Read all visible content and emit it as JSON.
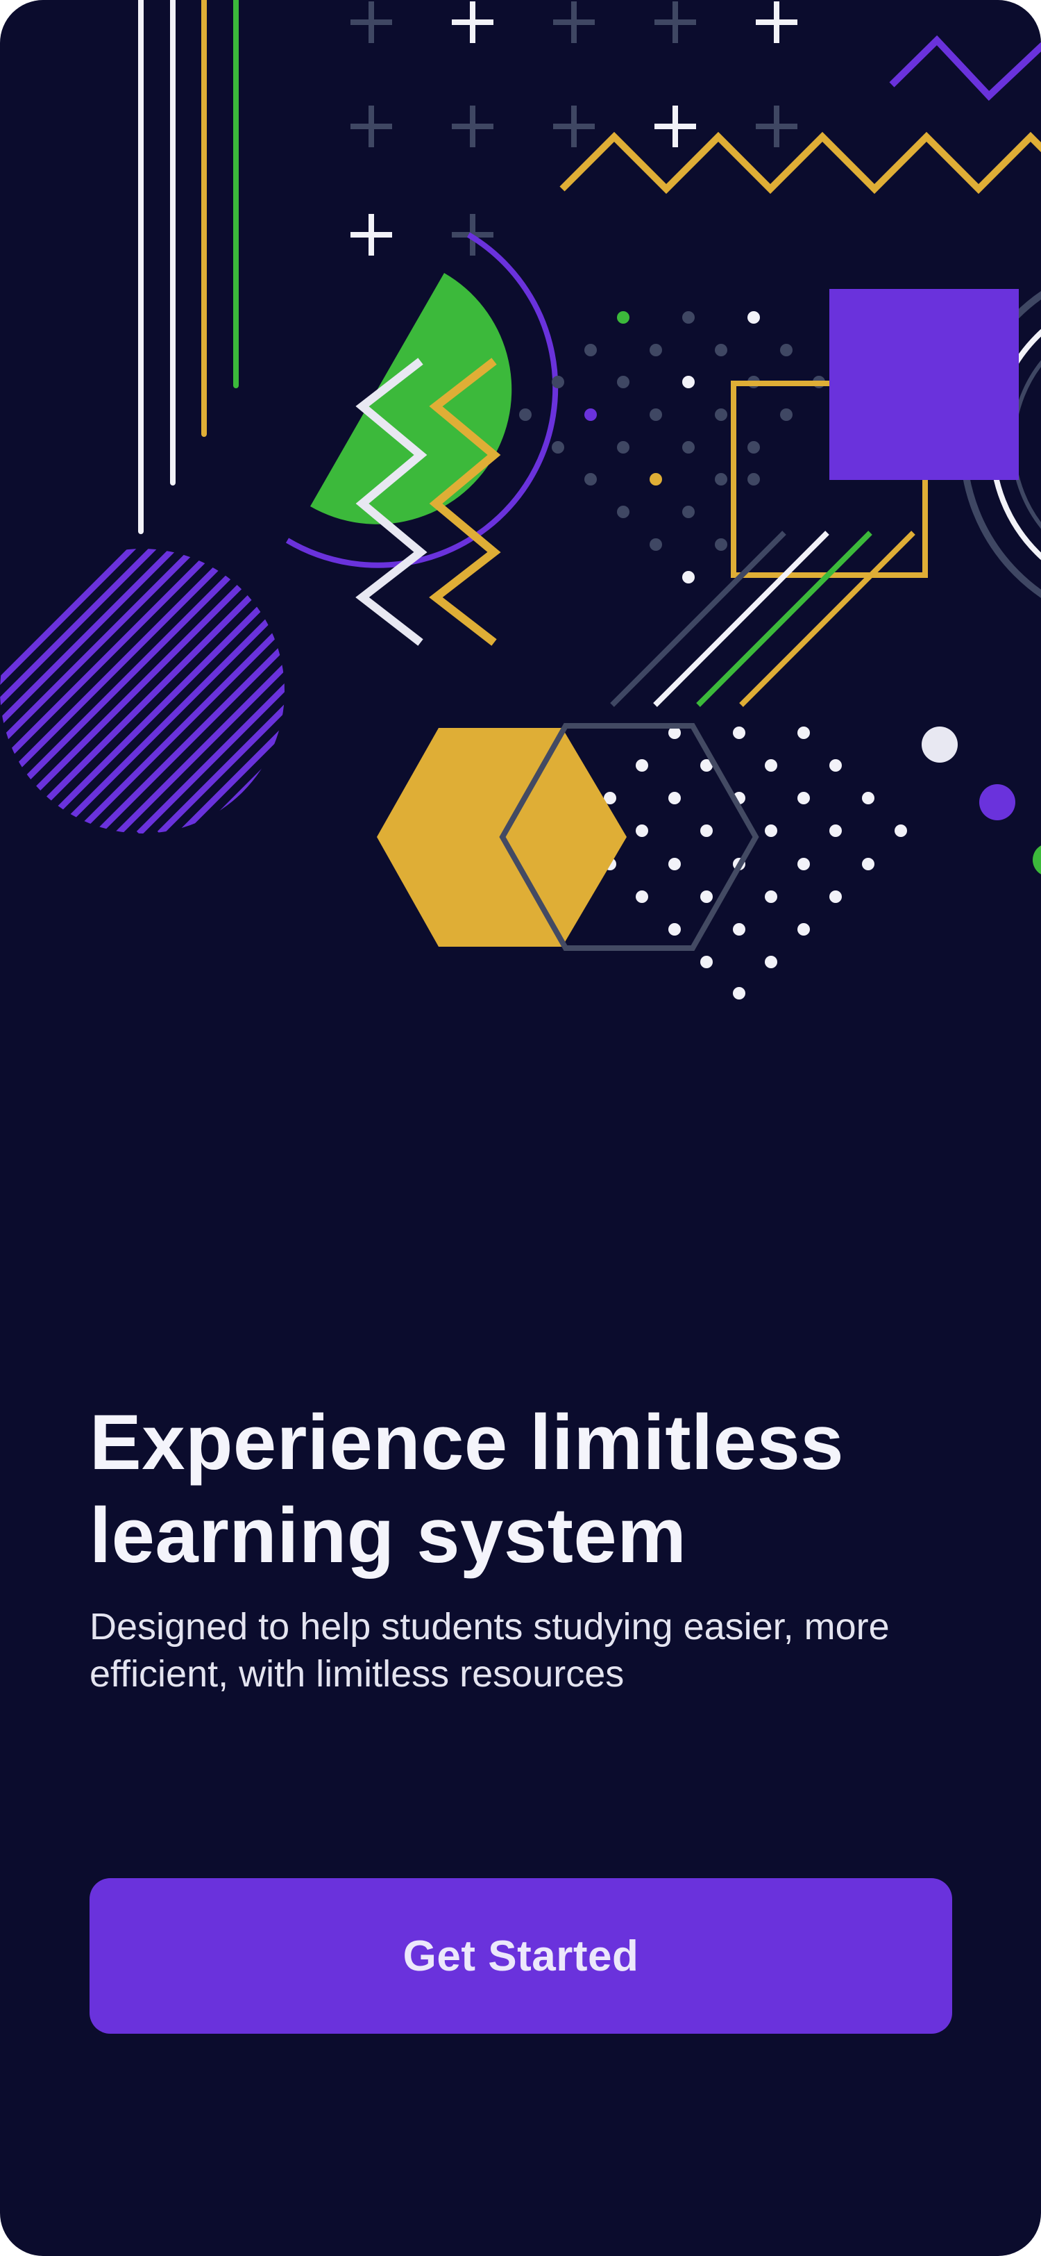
{
  "colors": {
    "background": "#0b0c2d",
    "accent_purple": "#6a32dc",
    "accent_yellow": "#dfae36",
    "accent_green": "#3cb93b",
    "muted_gray": "#3f4763",
    "white": "#f2f2f8"
  },
  "onboarding": {
    "headline": "Experience limitless learning system",
    "subtitle": "Designed to help students studying easier, more efficient, with limitless resources",
    "cta_label": "Get Started"
  }
}
